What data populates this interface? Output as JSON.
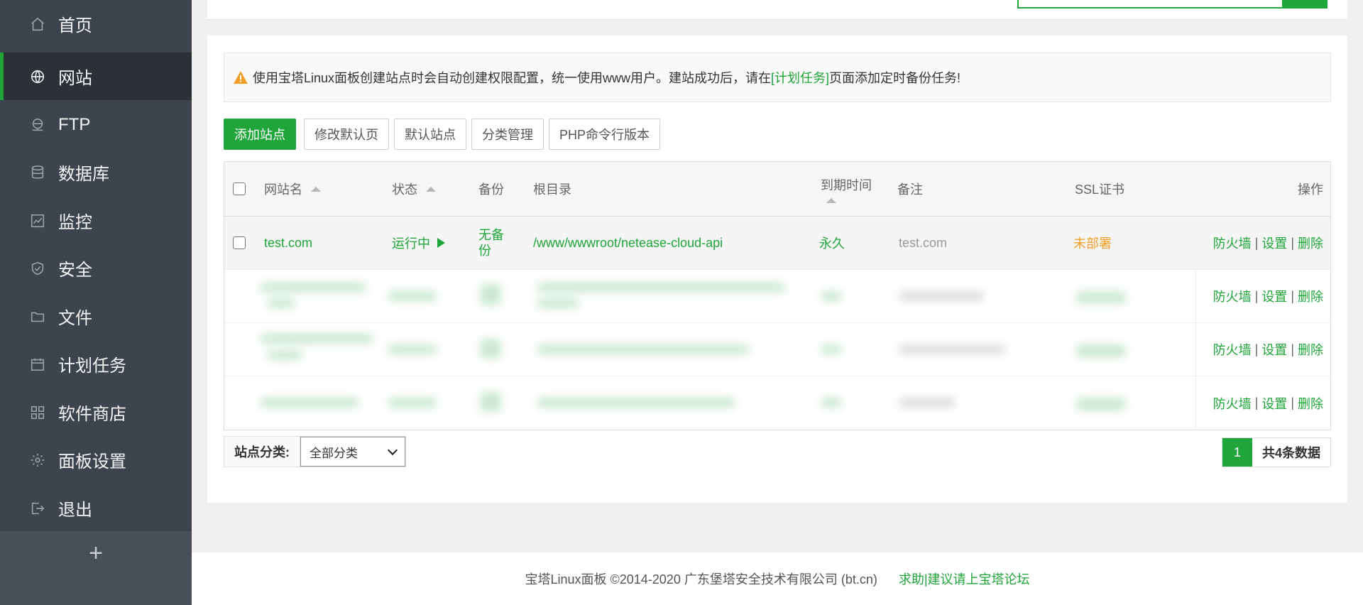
{
  "sidebar": {
    "items": [
      {
        "label": "首页",
        "icon": "home-icon"
      },
      {
        "label": "网站",
        "icon": "globe-icon"
      },
      {
        "label": "FTP",
        "icon": "ftp-icon"
      },
      {
        "label": "数据库",
        "icon": "database-icon"
      },
      {
        "label": "监控",
        "icon": "monitor-icon"
      },
      {
        "label": "安全",
        "icon": "shield-icon"
      },
      {
        "label": "文件",
        "icon": "folder-icon"
      },
      {
        "label": "计划任务",
        "icon": "calendar-icon"
      },
      {
        "label": "软件商店",
        "icon": "apps-icon"
      },
      {
        "label": "面板设置",
        "icon": "gear-icon"
      },
      {
        "label": "退出",
        "icon": "logout-icon"
      }
    ],
    "add_symbol": "+"
  },
  "notice": {
    "text_before": "使用宝塔Linux面板创建站点时会自动创建权限配置，统一使用www用户。建站成功后，请在",
    "link": "[计划任务]",
    "text_after": "页面添加定时备份任务!"
  },
  "toolbar": {
    "add_site": "添加站点",
    "edit_default_page": "修改默认页",
    "default_site": "默认站点",
    "category_manage": "分类管理",
    "php_cli_version": "PHP命令行版本"
  },
  "table": {
    "headers": {
      "name": "网站名",
      "status": "状态",
      "backup": "备份",
      "root": "根目录",
      "expire": "到期时间",
      "note": "备注",
      "ssl": "SSL证书",
      "ops": "操作"
    },
    "rows": [
      {
        "name": "test.com",
        "status": "运行中",
        "backup": "无备份",
        "root": "/www/wwwroot/netease-cloud-api",
        "expire": "永久",
        "note": "test.com",
        "ssl": "未部署"
      }
    ],
    "ops": {
      "firewall": "防火墙",
      "settings": "设置",
      "delete": "删除",
      "sep": "|"
    }
  },
  "footer_bar": {
    "category_label": "站点分类:",
    "category_selected": "全部分类",
    "current_page": "1",
    "total_text": "共4条数据"
  },
  "footer": {
    "copyright": "宝塔Linux面板 ©2014-2020 广东堡塔安全技术有限公司 (bt.cn)",
    "forum_link": "求助|建议请上宝塔论坛"
  },
  "colors": {
    "accent": "#20a53a",
    "sidebar_bg": "#3c444d",
    "warning": "#f0a02a"
  }
}
